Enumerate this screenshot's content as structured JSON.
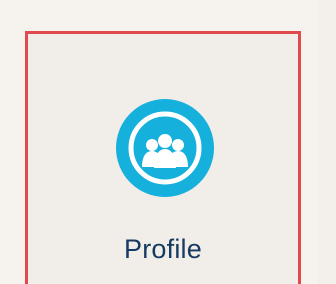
{
  "tile": {
    "label": "Profile",
    "icon": "people-group-icon",
    "accent_color": "#15b0db",
    "border_color": "#e04a4f",
    "text_color": "#173a63"
  }
}
